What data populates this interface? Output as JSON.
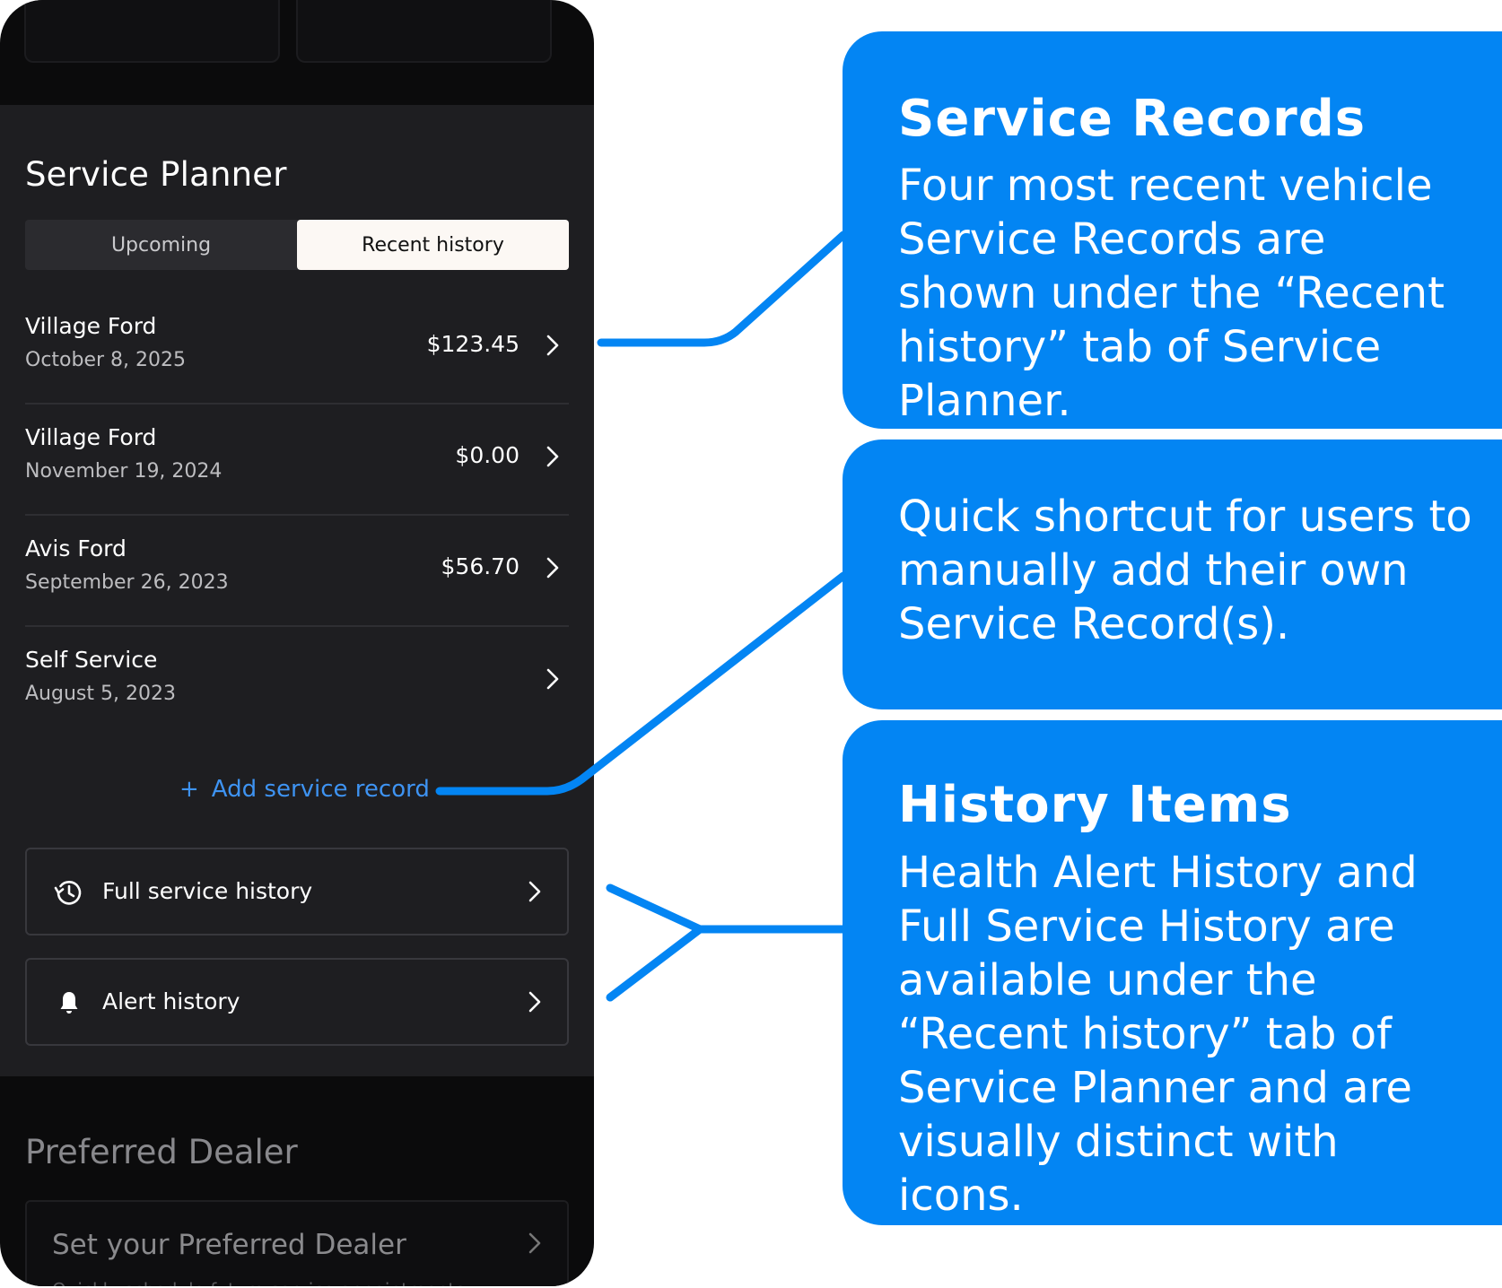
{
  "planner": {
    "title": "Service Planner",
    "tabs": [
      {
        "label": "Upcoming",
        "active": false
      },
      {
        "label": "Recent history",
        "active": true
      }
    ],
    "records": [
      {
        "dealer": "Village Ford",
        "date": "October 8, 2025",
        "amount": "$123.45"
      },
      {
        "dealer": "Village Ford",
        "date": "November 19, 2024",
        "amount": "$0.00"
      },
      {
        "dealer": "Avis Ford",
        "date": "September 26, 2023",
        "amount": "$56.70"
      },
      {
        "dealer": "Self Service",
        "date": "August 5, 2023",
        "amount": ""
      }
    ],
    "add_record": {
      "icon": "+",
      "label": "Add service record"
    },
    "history_items": [
      {
        "label": "Full service history",
        "icon": "history-icon"
      },
      {
        "label": "Alert history",
        "icon": "bell-icon"
      }
    ]
  },
  "dealer": {
    "title": "Preferred Dealer",
    "card_label": "Set your Preferred Dealer",
    "card_sub": "Quickly schedule future service appointments"
  },
  "callouts": {
    "records": {
      "title": "Service Records",
      "body": "Four most recent vehicle Service Records are shown under the “Recent history” tab of Service Planner."
    },
    "shortcut": {
      "body": "Quick shortcut for users to manually add their own Service Record(s)."
    },
    "history": {
      "title": "History Items",
      "body": "Health Alert History and Full Service History are available under the “Recent history” tab of Service Planner and are visually distinct with icons."
    }
  },
  "colors": {
    "accent_blue": "#0385f3",
    "link_blue": "#3e93f2",
    "panel_bg": "#1e1e21",
    "phone_bg": "#0b0b0c"
  }
}
